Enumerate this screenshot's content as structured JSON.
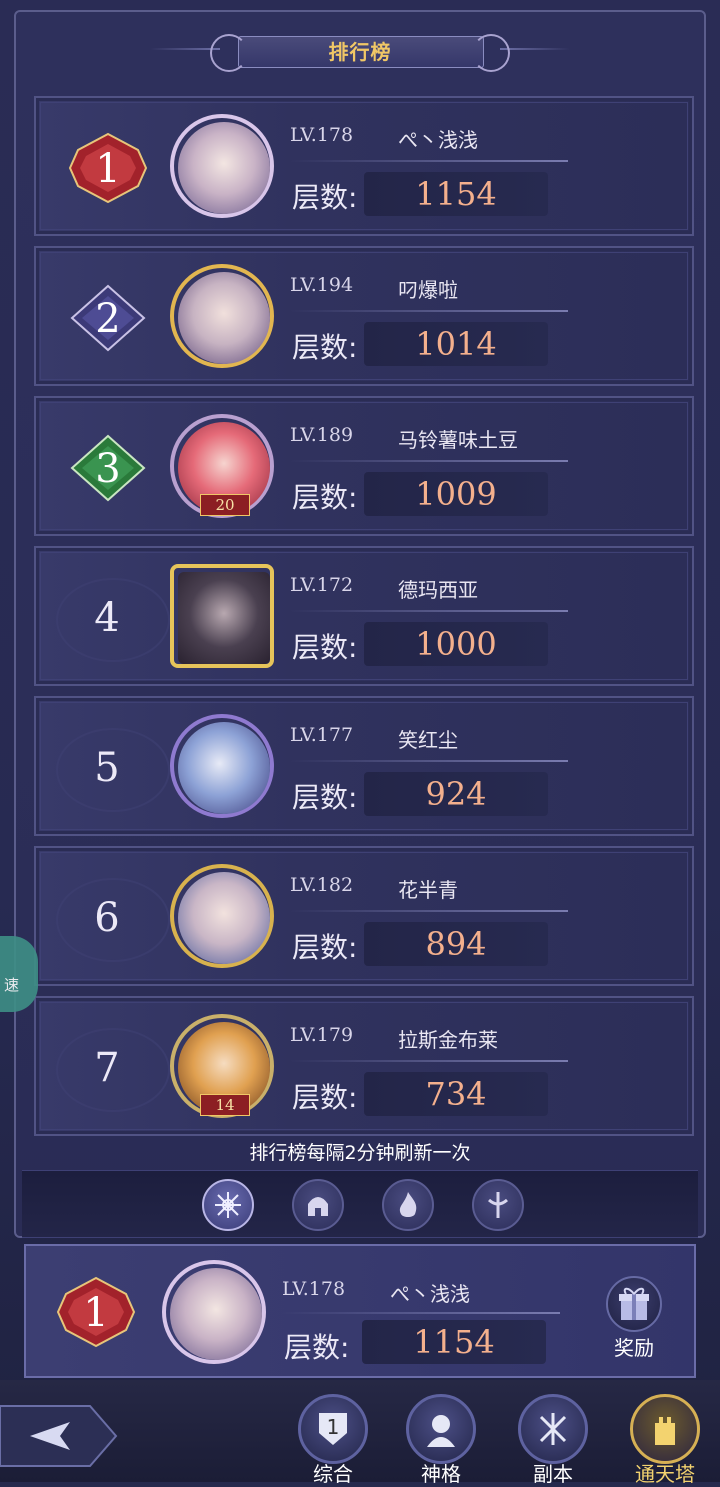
{
  "header": {
    "title": "排行榜"
  },
  "floor_label": "层数:",
  "rankings": [
    {
      "rank": "1",
      "level": "LV.178",
      "name": "ぺ丶浅浅",
      "floors": "1154",
      "medal_color": "#a2222b"
    },
    {
      "rank": "2",
      "level": "LV.194",
      "name": "叼爆啦",
      "floors": "1014",
      "medal_color": "#3c3a78"
    },
    {
      "rank": "3",
      "level": "LV.189",
      "name": "马铃薯味土豆",
      "floors": "1009",
      "medal_color": "#2a7a3a",
      "avatar_badge": "20"
    },
    {
      "rank": "4",
      "level": "LV.172",
      "name": "德玛西亚",
      "floors": "1000"
    },
    {
      "rank": "5",
      "level": "LV.177",
      "name": "笑红尘",
      "floors": "924"
    },
    {
      "rank": "6",
      "level": "LV.182",
      "name": "花半青",
      "floors": "894"
    },
    {
      "rank": "7",
      "level": "LV.179",
      "name": "拉斯金布莱",
      "floors": "734",
      "avatar_badge": "14"
    }
  ],
  "refresh_note": "排行榜每隔2分钟刷新一次",
  "category_tabs": [
    {
      "icon": "snowflake-emblem-icon",
      "active": true
    },
    {
      "icon": "helmet-emblem-icon",
      "active": false
    },
    {
      "icon": "flame-emblem-icon",
      "active": false
    },
    {
      "icon": "sword-emblem-icon",
      "active": false
    }
  ],
  "self": {
    "rank": "1",
    "level": "LV.178",
    "name": "ぺ丶浅浅",
    "floors": "1154"
  },
  "reward": {
    "label": "奖励",
    "icon": "gift-icon"
  },
  "speed_badge": {
    "label": "速"
  },
  "bottom_nav": [
    {
      "label": "综合",
      "icon": "shield-one-icon",
      "active": false
    },
    {
      "label": "神格",
      "icon": "portrait-icon",
      "active": false
    },
    {
      "label": "副本",
      "icon": "crossed-swords-icon",
      "active": false
    },
    {
      "label": "通天塔",
      "icon": "tower-icon",
      "active": true
    }
  ],
  "colors": {
    "accent": "#f0c766",
    "score": "#f4b08d",
    "panel": "#2e305c"
  }
}
